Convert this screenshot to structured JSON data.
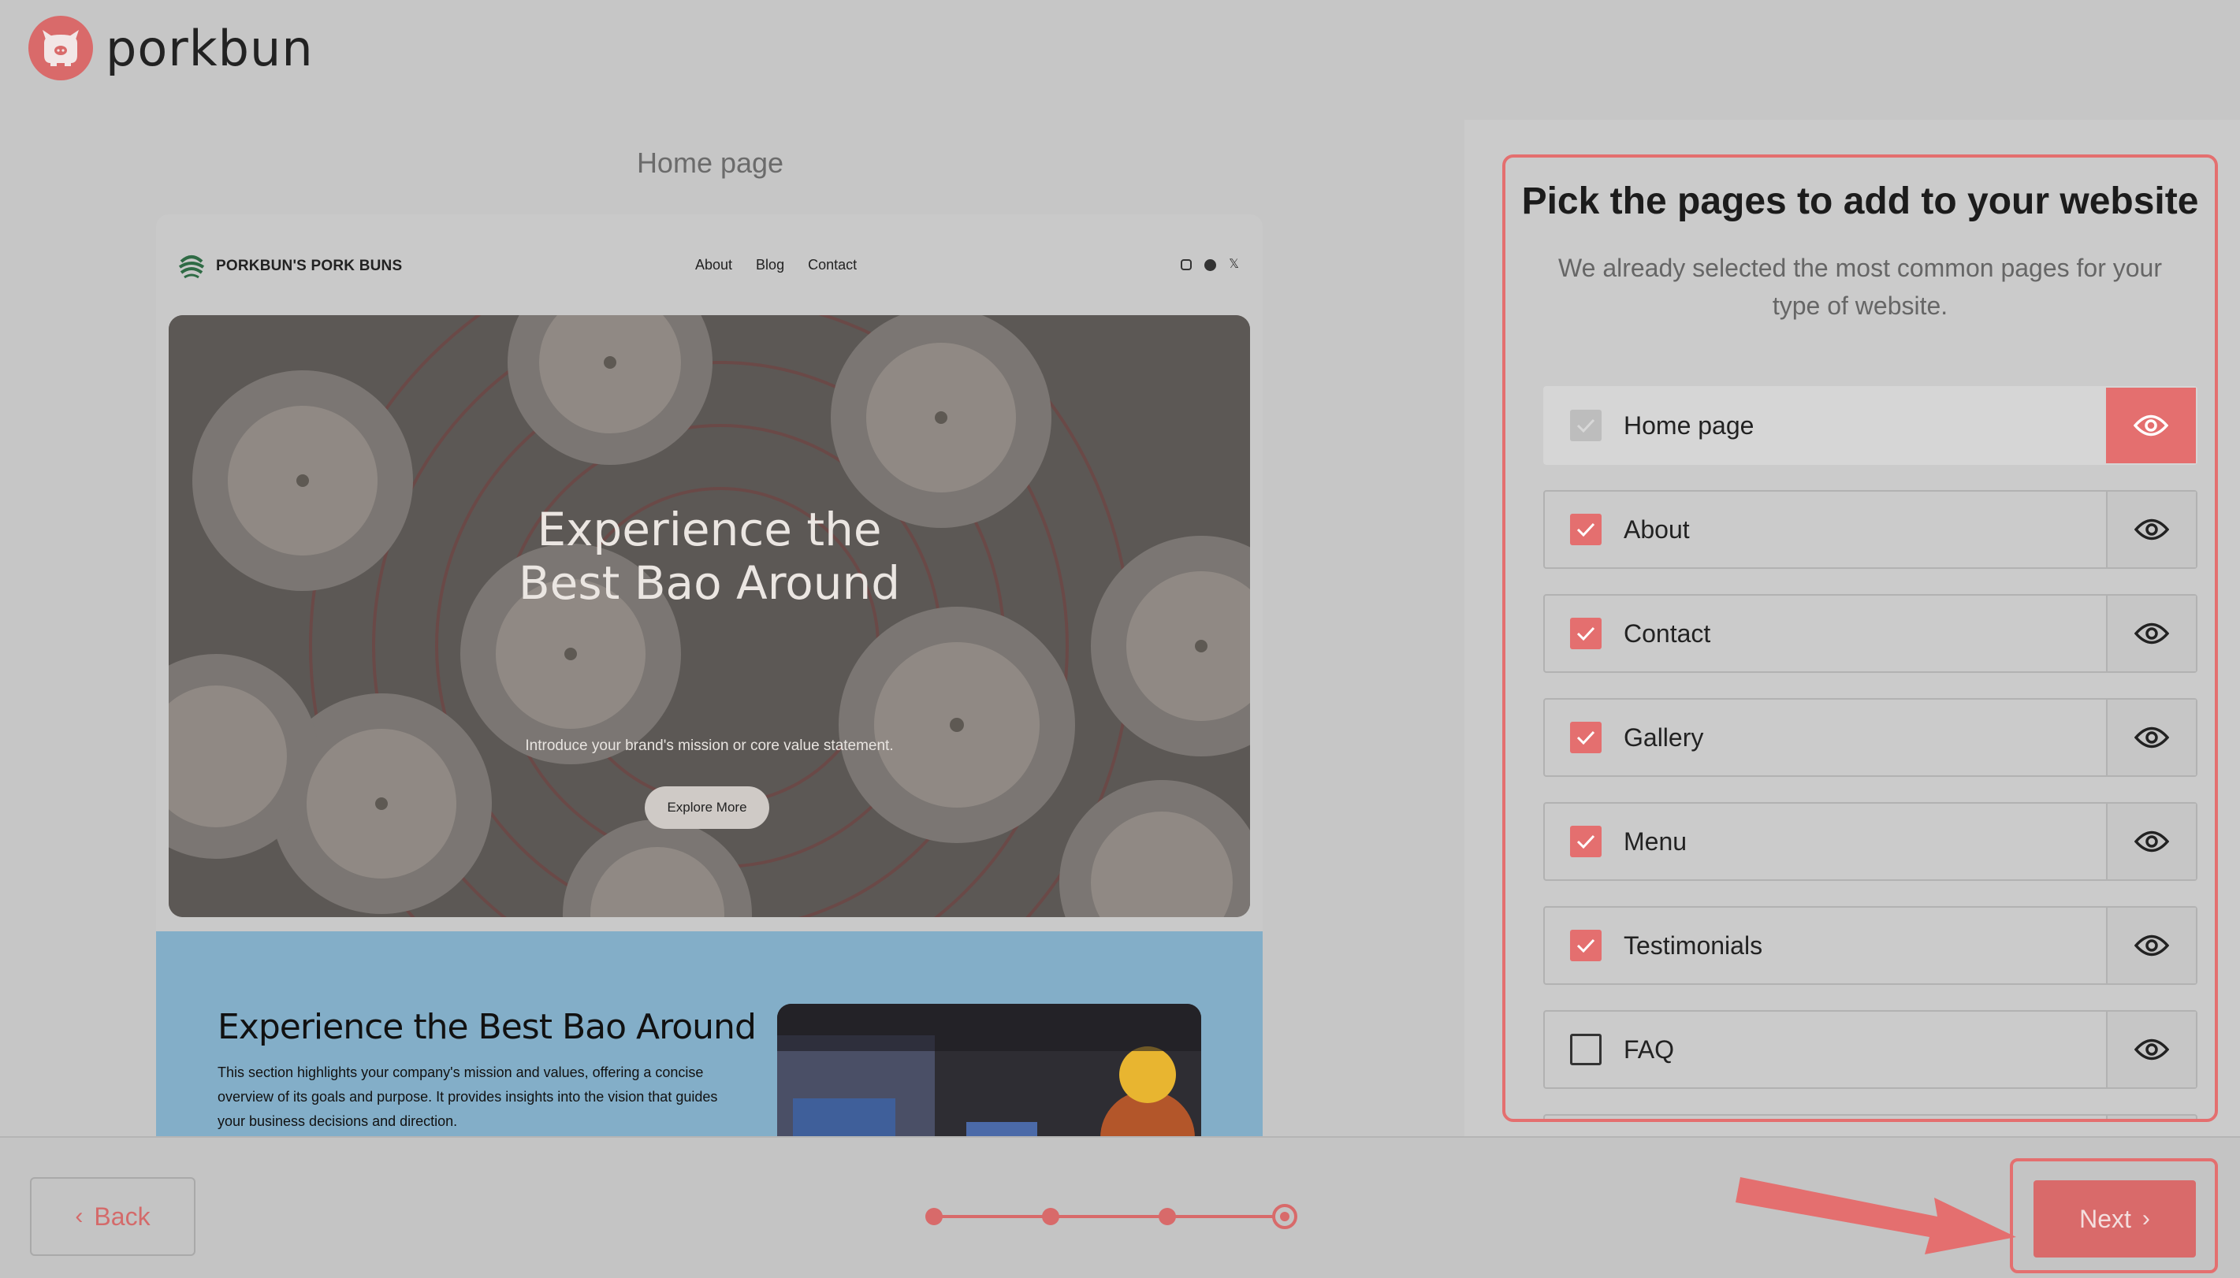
{
  "brand": {
    "name": "porkbun"
  },
  "preview": {
    "title": "Home page",
    "site": {
      "brand": "PORKBUN'S PORK BUNS",
      "nav": [
        "About",
        "Blog",
        "Contact"
      ],
      "social": [
        "instagram-icon",
        "facebook-icon",
        "x-icon"
      ],
      "social_x_glyph": "𝕏"
    },
    "hero": {
      "title_line1": "Experience the",
      "title_line2": "Best Bao Around",
      "subtitle": "Introduce your brand's mission or core value statement.",
      "button": "Explore More"
    },
    "section2": {
      "title": "Experience the Best Bao Around",
      "body": "This section highlights your company's mission and values, offering a concise overview of its goals and purpose. It provides insights into the vision that guides your business decisions and direction."
    }
  },
  "panel": {
    "title": "Pick the pages to add to your website",
    "subtitle": "We already selected the most common pages for your type of website.",
    "pages": [
      {
        "label": "Home page",
        "checked": true,
        "locked": true
      },
      {
        "label": "About",
        "checked": true
      },
      {
        "label": "Contact",
        "checked": true
      },
      {
        "label": "Gallery",
        "checked": true
      },
      {
        "label": "Menu",
        "checked": true
      },
      {
        "label": "Testimonials",
        "checked": true
      },
      {
        "label": "FAQ",
        "checked": false
      }
    ]
  },
  "footer": {
    "back_label": "Back",
    "next_label": "Next",
    "steps_total": 4,
    "current_step": 4
  },
  "colors": {
    "accent": "#e46f6f",
    "page_bg": "#c6c6c6"
  }
}
